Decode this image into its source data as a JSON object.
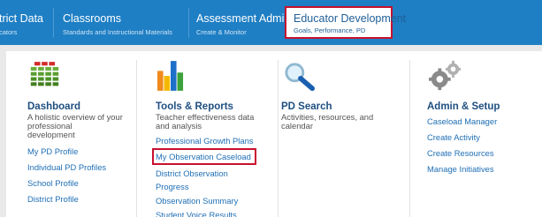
{
  "nav": {
    "items": [
      {
        "title": "trict Data",
        "subtitle": "cators"
      },
      {
        "title": "Classrooms",
        "subtitle": "Standards and Instructional Materials"
      },
      {
        "title": "Assessment Admin",
        "subtitle": "Create & Monitor"
      },
      {
        "title": "Educator Development",
        "subtitle": "Goals, Performance, PD"
      }
    ],
    "selected_index": 3
  },
  "columns": [
    {
      "icon": "dashboard-grid-icon",
      "title": "Dashboard",
      "desc_lines": [
        "A holistic overview of your",
        "professional",
        "development"
      ],
      "links": [
        "My PD Profile",
        "Individual PD Profiles",
        "School Profile",
        "District Profile"
      ]
    },
    {
      "icon": "bar-chart-icon",
      "title": "Tools & Reports",
      "desc_lines": [
        "Teacher effectiveness data",
        "and analysis"
      ],
      "links": [
        "Professional Growth Plans",
        "My Observation Caseload",
        "District Observation",
        "Progress",
        "Observation Summary",
        "Student Voice Results"
      ],
      "highlighted_link_index": 1
    },
    {
      "icon": "magnifier-icon",
      "title": "PD Search",
      "desc_lines": [
        "Activities, resources, and",
        "calendar"
      ],
      "links": []
    },
    {
      "icon": "gears-icon",
      "title": "Admin & Setup",
      "desc_lines": [],
      "links": [
        "Caseload Manager",
        "Create Activity",
        "Create Resources",
        "Manage Initiatives"
      ]
    }
  ],
  "colors": {
    "nav_bg": "#1f7fc4",
    "highlight_border": "#c8102e",
    "title_text": "#1f4f80",
    "link_text": "#1f6fb5"
  }
}
